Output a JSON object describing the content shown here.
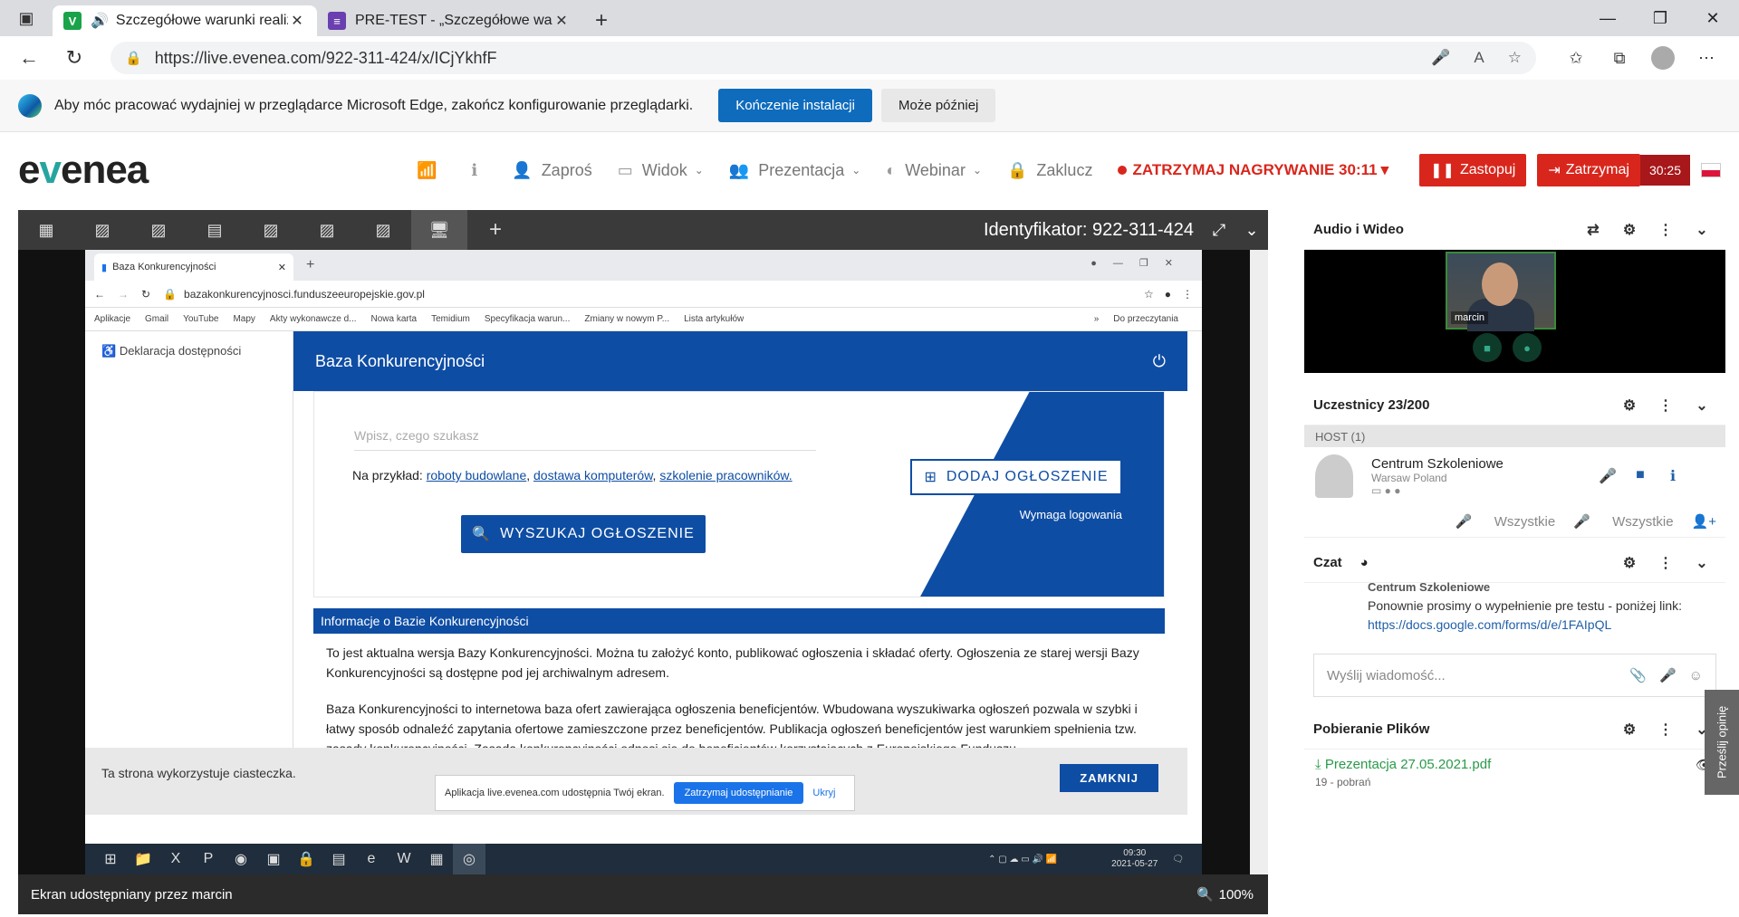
{
  "browser": {
    "tabs": [
      {
        "title": "Szczegółowe warunki realiz",
        "favicon": "V",
        "color": "#1aa34a"
      },
      {
        "title": "PRE-TEST - „Szczegółowe warunk",
        "favicon": "forms-icon",
        "color": "#6a3fb0"
      }
    ],
    "url": "https://live.evenea.com/922-311-424/x/ICjYkhfF"
  },
  "infobar": {
    "text": "Aby móc pracować wydajniej w przeglądarce Microsoft Edge, zakończ konfigurowanie przeglądarki.",
    "primary": "Kończenie instalacji",
    "secondary": "Może później"
  },
  "header": {
    "logo_pre": "e",
    "logo_v": "v",
    "logo_post": "enea",
    "menu": {
      "invite": "Zaproś",
      "view": "Widok",
      "presentation": "Prezentacja",
      "webinar": "Webinar",
      "lock": "Zaklucz"
    },
    "recording": "ZATRZYMAJ NAGRYWANIE 30:11",
    "replace": "Zastopuj",
    "stop": "Zatrzymaj",
    "timer": "30:25"
  },
  "stage": {
    "identifier": "Identyfikator: 922-311-424",
    "footer": "Ekran udostępniany przez marcin",
    "zoom": "100%"
  },
  "shared": {
    "tab": "Baza Konkurencyjności",
    "url": "bazakonkurencyjnosci.funduszeeuropejskie.gov.pl",
    "bookmarks": [
      "Aplikacje",
      "Gmail",
      "YouTube",
      "Mapy",
      "Akty wykonawcze d...",
      "Nowa karta",
      "Temidium",
      "Specyfikacja warun...",
      "Zmiany w nowym P...",
      "Lista artykułów"
    ],
    "bookmarks_more": "»",
    "reading_list": "Do przeczytania",
    "side_link": "Deklaracja dostępności",
    "site_title": "Baza Konkurencyjności",
    "search_placeholder": "Wpisz, czego szukasz",
    "examples_prefix": "Na przykład:",
    "example_links": [
      "roboty budowlane",
      "dostawa komputerów",
      "szkolenie pracowników."
    ],
    "search_button": "WYSZUKAJ OGŁOSZENIE",
    "add_button": "DODAJ OGŁOSZENIE",
    "login_required": "Wymaga logowania",
    "info_title": "Informacje o Bazie Konkurencyjności",
    "para1": "To jest aktualna wersja Bazy Konkurencyjności. Można tu założyć konto, publikować ogłoszenia i składać oferty. Ogłoszenia ze starej wersji Bazy Konkurencyjności są dostępne pod jej archiwalnym adresem.",
    "para2": "Baza Konkurencyjności to internetowa baza ofert zawierająca ogłoszenia beneficjentów. Wbudowana wyszukiwarka ogłoszeń pozwala w szybki i łatwy sposób odnaleźć zapytania ofertowe zamieszczone przez beneficjentów. Publikacja ogłoszeń beneficjentów jest warunkiem spełnienia tzw. zasady konkurencyjności. Zasada konkurencyjności odnosi się do beneficjentów korzystających z Europejskiego Funduszu",
    "cookie_text": "Ta strona wykorzystuje ciasteczka.",
    "cookie_close": "ZAMKNIJ",
    "share_text": "Aplikacja live.evenea.com udostępnia Twój ekran.",
    "share_stop": "Zatrzymaj udostępnianie",
    "share_hide": "Ukryj",
    "clock_time": "09:30",
    "clock_date": "2021-05-27"
  },
  "right": {
    "av_title": "Audio i Wideo",
    "video_name": "marcin",
    "participants_title": "Uczestnicy 23/200",
    "host_label": "HOST (1)",
    "host_name": "Centrum Szkoleniowe",
    "host_location": "Warsaw Poland",
    "all_mic": "Wszystkie",
    "all_hand": "Wszystkie",
    "chat_title": "Czat",
    "chat_author": "Centrum Szkoleniowe",
    "chat_message": "Ponownie prosimy o wypełnienie pre testu - poniżej link:",
    "chat_link": "https://docs.google.com/forms/d/e/1FAIpQL",
    "chat_placeholder": "Wyślij wiadomość...",
    "files_title": "Pobieranie Plików",
    "file_name": "Prezentacja 27.05.2021.pdf",
    "file_count": "19 - pobrań",
    "feedback": "Prześlij opinię"
  }
}
